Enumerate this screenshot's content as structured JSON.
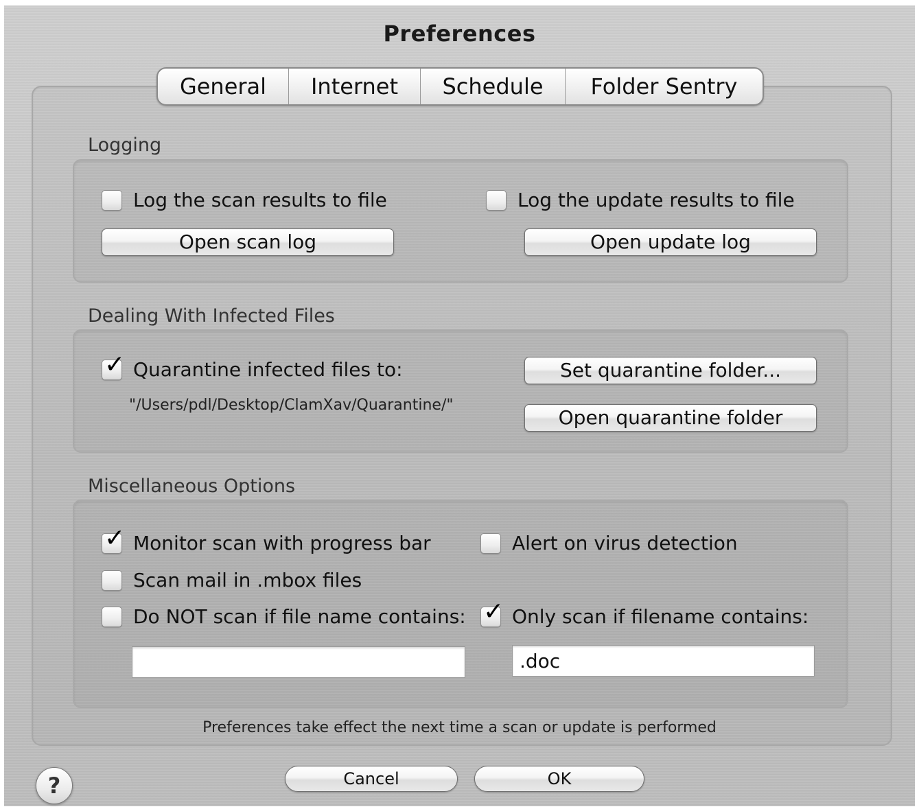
{
  "window": {
    "title": "Preferences"
  },
  "tabs": [
    {
      "label": "General"
    },
    {
      "label": "Internet"
    },
    {
      "label": "Schedule"
    },
    {
      "label": "Folder Sentry"
    }
  ],
  "logging": {
    "label": "Logging",
    "log_scan": {
      "label": "Log the scan results to file",
      "checked": false
    },
    "log_update": {
      "label": "Log the update results to file",
      "checked": false
    },
    "open_scan_log": "Open scan log",
    "open_update_log": "Open update log"
  },
  "infected": {
    "label": "Dealing With Infected Files",
    "quarantine": {
      "label": "Quarantine infected files to:",
      "checked": true
    },
    "path": "\"/Users/pdl/Desktop/ClamXav/Quarantine/\"",
    "set_folder": "Set quarantine folder...",
    "open_folder": "Open quarantine folder"
  },
  "misc": {
    "label": "Miscellaneous Options",
    "monitor": {
      "label": "Monitor scan with progress bar",
      "checked": true
    },
    "alert": {
      "label": "Alert on virus detection",
      "checked": false
    },
    "mbox": {
      "label": "Scan mail in .mbox files",
      "checked": false
    },
    "exclude": {
      "label": "Do NOT scan if file name contains:",
      "checked": false,
      "value": ""
    },
    "include": {
      "label": "Only scan if filename contains:",
      "checked": true,
      "value": ".doc"
    }
  },
  "footnote": "Preferences take effect the next time a scan or update is performed",
  "buttons": {
    "cancel": "Cancel",
    "ok": "OK",
    "help": "?"
  },
  "check_glyph": "✓"
}
